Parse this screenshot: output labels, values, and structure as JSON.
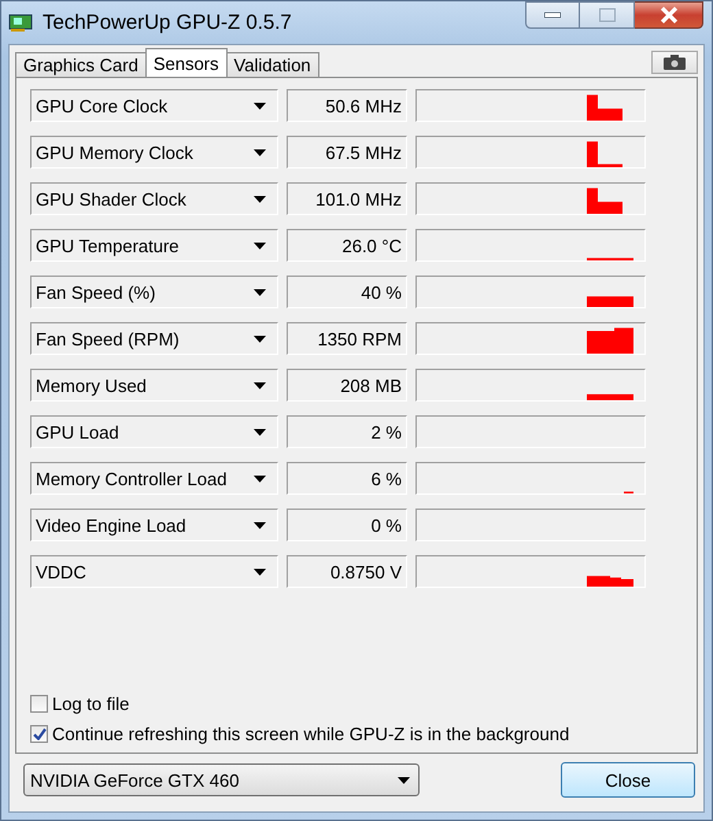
{
  "window": {
    "title": "TechPowerUp GPU-Z 0.5.7"
  },
  "tabs": [
    {
      "label": "Graphics Card",
      "selected": false
    },
    {
      "label": "Sensors",
      "selected": true
    },
    {
      "label": "Validation",
      "selected": false
    }
  ],
  "sensors": [
    {
      "name": "GPU Core Clock",
      "reading": "50.6 MHz"
    },
    {
      "name": "GPU Memory Clock",
      "reading": "67.5 MHz"
    },
    {
      "name": "GPU Shader Clock",
      "reading": "101.0 MHz"
    },
    {
      "name": "GPU Temperature",
      "reading": "26.0 °C"
    },
    {
      "name": "Fan Speed (%)",
      "reading": "40 %"
    },
    {
      "name": "Fan Speed (RPM)",
      "reading": "1350 RPM"
    },
    {
      "name": "Memory Used",
      "reading": "208 MB"
    },
    {
      "name": "GPU Load",
      "reading": "2 %"
    },
    {
      "name": "Memory Controller Load",
      "reading": "6 %"
    },
    {
      "name": "Video Engine Load",
      "reading": "0 %"
    },
    {
      "name": "VDDC",
      "reading": "0.8750 V"
    }
  ],
  "options": [
    {
      "label": "Log to file",
      "checked": false
    },
    {
      "label": "Continue refreshing this screen while GPU-Z is in the background",
      "checked": true
    }
  ],
  "card_select": {
    "value": "NVIDIA GeForce GTX 460"
  },
  "buttons": [
    "Close"
  ]
}
